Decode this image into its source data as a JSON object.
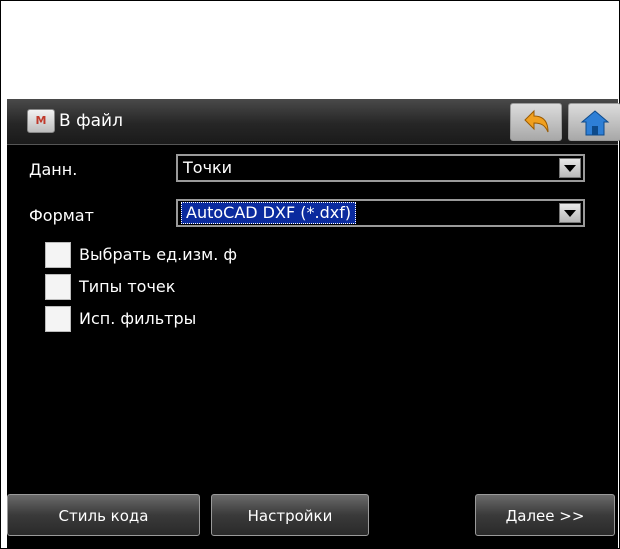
{
  "window": {
    "title": "В файл",
    "logo_text": "M"
  },
  "form": {
    "data_label": "Данн.",
    "data_value": "Точки",
    "format_label": "Формат",
    "format_value": "AutoCAD DXF (*.dxf)"
  },
  "checkboxes": [
    {
      "label": "Выбрать ед.изм. ф",
      "checked": false
    },
    {
      "label": "Типы точек",
      "checked": false
    },
    {
      "label": "Исп. фильтры",
      "checked": false
    }
  ],
  "buttons": {
    "code_style": "Стиль кода",
    "settings": "Настройки",
    "next": "Далее >>"
  },
  "colors": {
    "background": "#000000",
    "selection": "#0a2a9e",
    "back_arrow": "#f0a020",
    "home": "#2e7fd6"
  },
  "icons": {
    "back": "undo-arrow-icon",
    "home": "home-icon"
  }
}
